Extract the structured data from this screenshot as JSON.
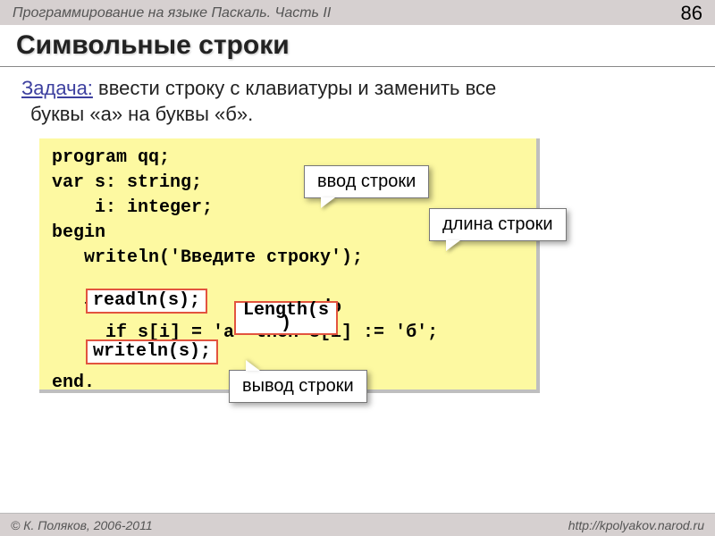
{
  "header": {
    "doc_title": "Программирование на языке Паскаль. Часть II",
    "page_number": "86"
  },
  "title": "Символьные строки",
  "problem": {
    "lead": "Задача:",
    "text_line1": " ввести строку с клавиатуры и заменить все",
    "text_line2": "буквы «а» на буквы «б»."
  },
  "code": {
    "l1": "program qq;",
    "l2": "var s: string;",
    "l3": "    i: integer;",
    "l4": "begin",
    "l5": "   writeln('Введите строку');",
    "l6_blank": "",
    "l7": "   for i:=1 to           do",
    "l8": "     if s[i] = 'а' then s[i] := 'б';",
    "l9_blank": "",
    "l10": "end.",
    "hl_readln": "readln(s);",
    "hl_writeln": "writeln(s);",
    "hl_length_l1": "Length(s",
    "hl_length_l2": ")"
  },
  "callouts": {
    "input": "ввод строки",
    "length": "длина строки",
    "output": "вывод строки"
  },
  "footer": {
    "copyright": "© К. Поляков, 2006-2011",
    "url": "http://kpolyakov.narod.ru"
  }
}
